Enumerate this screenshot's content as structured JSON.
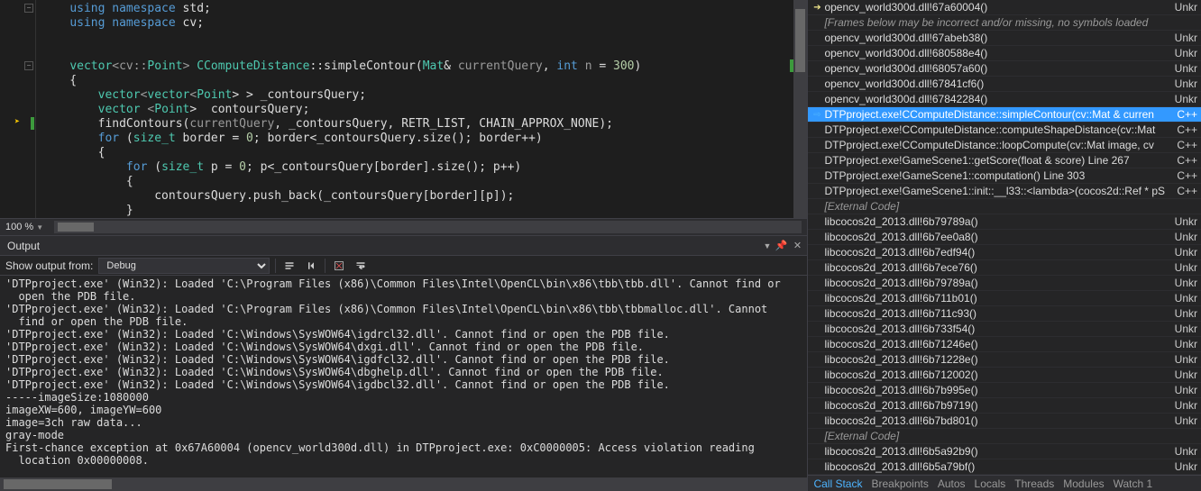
{
  "editor": {
    "lines": [
      {
        "tokens": [
          {
            "t": "    ",
            "c": "white"
          },
          {
            "t": "using namespace",
            "c": "kw"
          },
          {
            "t": " std;",
            "c": "white"
          }
        ],
        "collapse": "-"
      },
      {
        "tokens": [
          {
            "t": "    ",
            "c": "white"
          },
          {
            "t": "using namespace",
            "c": "kw"
          },
          {
            "t": " cv;",
            "c": "white"
          }
        ]
      },
      {
        "tokens": [
          {
            "t": " ",
            "c": "white"
          }
        ]
      },
      {
        "tokens": [
          {
            "t": " ",
            "c": "white"
          }
        ]
      },
      {
        "tokens": [
          {
            "t": "    ",
            "c": "white"
          },
          {
            "t": "vector",
            "c": "type"
          },
          {
            "t": "<cv::",
            "c": "gray"
          },
          {
            "t": "Point",
            "c": "type"
          },
          {
            "t": "> ",
            "c": "gray"
          },
          {
            "t": "CComputeDistance",
            "c": "type"
          },
          {
            "t": "::simpleContour(",
            "c": "white"
          },
          {
            "t": "Mat",
            "c": "type"
          },
          {
            "t": "& ",
            "c": "white"
          },
          {
            "t": "currentQuery",
            "c": "gray"
          },
          {
            "t": ", ",
            "c": "white"
          },
          {
            "t": "int",
            "c": "kw"
          },
          {
            "t": " ",
            "c": "white"
          },
          {
            "t": "n",
            "c": "gray"
          },
          {
            "t": " = ",
            "c": "white"
          },
          {
            "t": "300",
            "c": "num"
          },
          {
            "t": ")",
            "c": "white"
          }
        ],
        "collapse": "-"
      },
      {
        "tokens": [
          {
            "t": "    {",
            "c": "white"
          }
        ]
      },
      {
        "tokens": [
          {
            "t": "        ",
            "c": "white"
          },
          {
            "t": "vector",
            "c": "type"
          },
          {
            "t": "<",
            "c": "gray"
          },
          {
            "t": "vector",
            "c": "type"
          },
          {
            "t": "<",
            "c": "gray"
          },
          {
            "t": "Point",
            "c": "type"
          },
          {
            "t": "> > _contoursQuery;",
            "c": "white"
          }
        ]
      },
      {
        "tokens": [
          {
            "t": "        ",
            "c": "white"
          },
          {
            "t": "vector",
            "c": "type"
          },
          {
            "t": " <",
            "c": "gray"
          },
          {
            "t": "Point",
            "c": "type"
          },
          {
            "t": ">  contoursQuery;",
            "c": "white"
          }
        ]
      },
      {
        "tokens": [
          {
            "t": "        findContours(",
            "c": "white"
          },
          {
            "t": "currentQuery",
            "c": "gray"
          },
          {
            "t": ", _contoursQuery, ",
            "c": "white"
          },
          {
            "t": "RETR_LIST",
            "c": "fn"
          },
          {
            "t": ", ",
            "c": "white"
          },
          {
            "t": "CHAIN_APPROX_NONE",
            "c": "fn"
          },
          {
            "t": ");",
            "c": "white"
          }
        ],
        "exec": true
      },
      {
        "tokens": [
          {
            "t": "        ",
            "c": "white"
          },
          {
            "t": "for",
            "c": "kw"
          },
          {
            "t": " (",
            "c": "white"
          },
          {
            "t": "size_t",
            "c": "type"
          },
          {
            "t": " border = ",
            "c": "white"
          },
          {
            "t": "0",
            "c": "num"
          },
          {
            "t": "; border<_contoursQuery.size(); border++)",
            "c": "white"
          }
        ]
      },
      {
        "tokens": [
          {
            "t": "        {",
            "c": "white"
          }
        ]
      },
      {
        "tokens": [
          {
            "t": "            ",
            "c": "white"
          },
          {
            "t": "for",
            "c": "kw"
          },
          {
            "t": " (",
            "c": "white"
          },
          {
            "t": "size_t",
            "c": "type"
          },
          {
            "t": " p = ",
            "c": "white"
          },
          {
            "t": "0",
            "c": "num"
          },
          {
            "t": "; p<_contoursQuery[border].size(); p++)",
            "c": "white"
          }
        ]
      },
      {
        "tokens": [
          {
            "t": "            {",
            "c": "white"
          }
        ]
      },
      {
        "tokens": [
          {
            "t": "                contoursQuery.push_back(_contoursQuery[border][p]);",
            "c": "white"
          }
        ]
      },
      {
        "tokens": [
          {
            "t": "            }",
            "c": "white"
          }
        ]
      }
    ]
  },
  "zoom": {
    "level": "100 %"
  },
  "output": {
    "title": "Output",
    "show_from_label": "Show output from:",
    "source": "Debug",
    "lines": [
      "'DTPproject.exe' (Win32): Loaded 'C:\\Program Files (x86)\\Common Files\\Intel\\OpenCL\\bin\\x86\\tbb\\tbb.dll'. Cannot find or",
      "  open the PDB file.",
      "'DTPproject.exe' (Win32): Loaded 'C:\\Program Files (x86)\\Common Files\\Intel\\OpenCL\\bin\\x86\\tbb\\tbbmalloc.dll'. Cannot",
      "  find or open the PDB file.",
      "'DTPproject.exe' (Win32): Loaded 'C:\\Windows\\SysWOW64\\igdrcl32.dll'. Cannot find or open the PDB file.",
      "'DTPproject.exe' (Win32): Loaded 'C:\\Windows\\SysWOW64\\dxgi.dll'. Cannot find or open the PDB file.",
      "'DTPproject.exe' (Win32): Loaded 'C:\\Windows\\SysWOW64\\igdfcl32.dll'. Cannot find or open the PDB file.",
      "'DTPproject.exe' (Win32): Loaded 'C:\\Windows\\SysWOW64\\dbghelp.dll'. Cannot find or open the PDB file.",
      "'DTPproject.exe' (Win32): Loaded 'C:\\Windows\\SysWOW64\\igdbcl32.dll'. Cannot find or open the PDB file.",
      "-----imageSize:1080000",
      "imageXW=600, imageYW=600",
      "image=3ch raw data...",
      "gray-mode",
      "First-chance exception at 0x67A60004 (opencv_world300d.dll) in DTPproject.exe: 0xC0000005: Access violation reading",
      "  location 0x00000008."
    ]
  },
  "callstack": {
    "frames": [
      {
        "name": "opencv_world300d.dll!67a60004()",
        "lang": "Unkr",
        "icon": "yel"
      },
      {
        "name": "[Frames below may be incorrect and/or missing, no symbols loaded",
        "lang": "",
        "muted": true
      },
      {
        "name": "opencv_world300d.dll!67abeb38()",
        "lang": "Unkr"
      },
      {
        "name": "opencv_world300d.dll!680588e4()",
        "lang": "Unkr"
      },
      {
        "name": "opencv_world300d.dll!68057a60()",
        "lang": "Unkr"
      },
      {
        "name": "opencv_world300d.dll!67841cf6()",
        "lang": "Unkr"
      },
      {
        "name": "opencv_world300d.dll!67842284()",
        "lang": "Unkr"
      },
      {
        "name": "DTPproject.exe!CComputeDistance::simpleContour(cv::Mat & curren",
        "lang": "C++",
        "sel": true,
        "icon": "blue"
      },
      {
        "name": "DTPproject.exe!CComputeDistance::computeShapeDistance(cv::Mat",
        "lang": "C++"
      },
      {
        "name": "DTPproject.exe!CComputeDistance::loopCompute(cv::Mat image, cv",
        "lang": "C++"
      },
      {
        "name": "DTPproject.exe!GameScene1::getScore(float & score) Line 267",
        "lang": "C++"
      },
      {
        "name": "DTPproject.exe!GameScene1::computation() Line 303",
        "lang": "C++"
      },
      {
        "name": "DTPproject.exe!GameScene1::init::__l33::<lambda>(cocos2d::Ref * pS",
        "lang": "C++"
      },
      {
        "name": "[External Code]",
        "lang": "",
        "muted": true
      },
      {
        "name": "libcocos2d_2013.dll!6b79789a()",
        "lang": "Unkr"
      },
      {
        "name": "libcocos2d_2013.dll!6b7ee0a8()",
        "lang": "Unkr"
      },
      {
        "name": "libcocos2d_2013.dll!6b7edf94()",
        "lang": "Unkr"
      },
      {
        "name": "libcocos2d_2013.dll!6b7ece76()",
        "lang": "Unkr"
      },
      {
        "name": "libcocos2d_2013.dll!6b79789a()",
        "lang": "Unkr"
      },
      {
        "name": "libcocos2d_2013.dll!6b711b01()",
        "lang": "Unkr"
      },
      {
        "name": "libcocos2d_2013.dll!6b711c93()",
        "lang": "Unkr"
      },
      {
        "name": "libcocos2d_2013.dll!6b733f54()",
        "lang": "Unkr"
      },
      {
        "name": "libcocos2d_2013.dll!6b71246e()",
        "lang": "Unkr"
      },
      {
        "name": "libcocos2d_2013.dll!6b71228e()",
        "lang": "Unkr"
      },
      {
        "name": "libcocos2d_2013.dll!6b712002()",
        "lang": "Unkr"
      },
      {
        "name": "libcocos2d_2013.dll!6b7b995e()",
        "lang": "Unkr"
      },
      {
        "name": "libcocos2d_2013.dll!6b7b9719()",
        "lang": "Unkr"
      },
      {
        "name": "libcocos2d_2013.dll!6b7bd801()",
        "lang": "Unkr"
      },
      {
        "name": "[External Code]",
        "lang": "",
        "muted": true
      },
      {
        "name": "libcocos2d_2013.dll!6b5a92b9()",
        "lang": "Unkr"
      },
      {
        "name": "libcocos2d_2013.dll!6b5a79bf()",
        "lang": "Unkr"
      }
    ],
    "tabs": [
      "Call Stack",
      "Breakpoints",
      "Autos",
      "Locals",
      "Threads",
      "Modules",
      "Watch 1"
    ],
    "active_tab": 0
  }
}
